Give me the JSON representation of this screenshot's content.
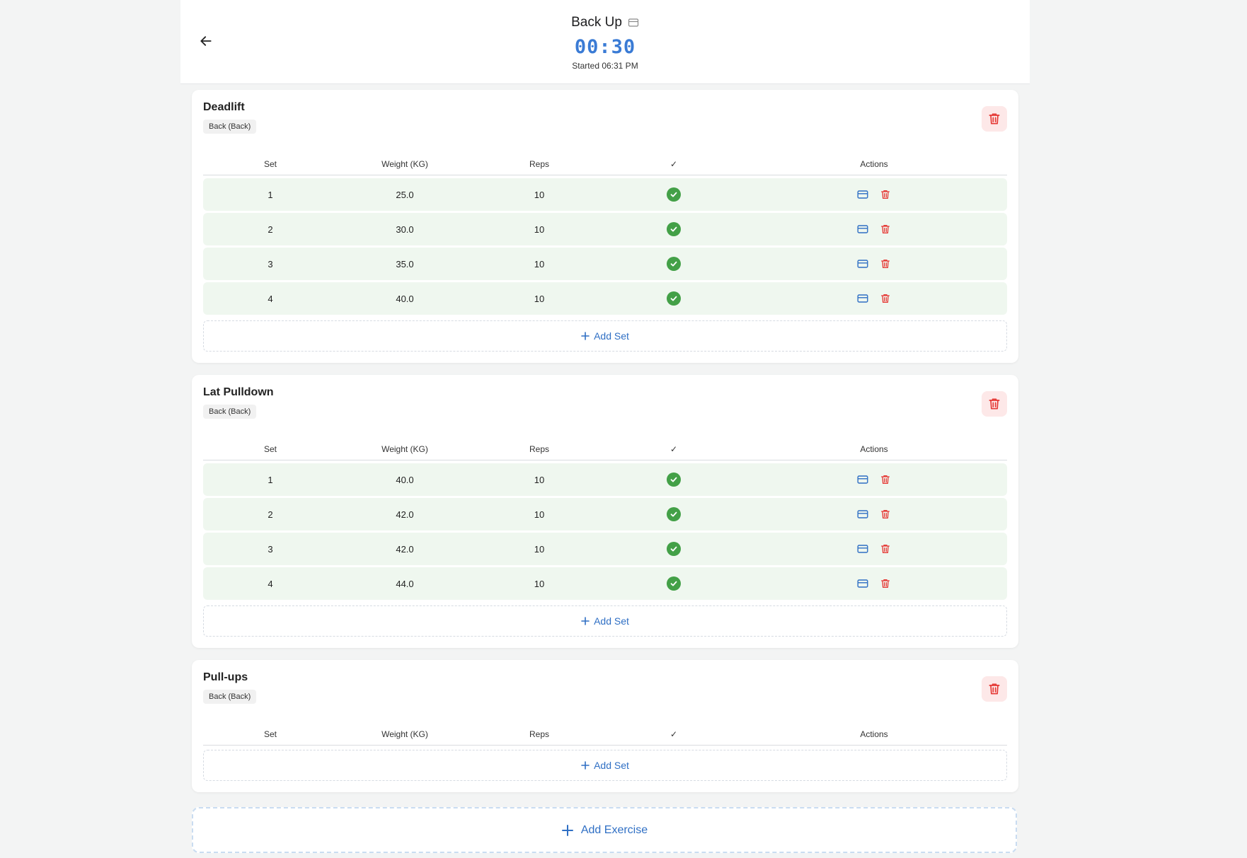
{
  "header": {
    "title": "Back Up",
    "timer": "00:30",
    "started": "Started 06:31 PM"
  },
  "table_headers": {
    "set": "Set",
    "weight": "Weight (KG)",
    "reps": "Reps",
    "done": "✓",
    "actions": "Actions"
  },
  "add_set_label": "Add Set",
  "add_exercise_label": "Add Exercise",
  "colors": {
    "accent": "#3a7bd5",
    "done_green": "#43a047",
    "row_bg": "#eff7ef",
    "delete_red": "#e53935",
    "delete_bg": "#fde8e8"
  },
  "icons": {
    "back": "arrow-left-icon",
    "title_edit": "card-icon",
    "delete": "trash-icon",
    "edit": "card-icon",
    "done": "check-circle-icon",
    "add": "plus-icon"
  },
  "exercises": [
    {
      "name": "Deadlift",
      "tag": "Back (Back)",
      "sets": [
        {
          "set": "1",
          "weight": "25.0",
          "reps": "10",
          "done": true
        },
        {
          "set": "2",
          "weight": "30.0",
          "reps": "10",
          "done": true
        },
        {
          "set": "3",
          "weight": "35.0",
          "reps": "10",
          "done": true
        },
        {
          "set": "4",
          "weight": "40.0",
          "reps": "10",
          "done": true
        }
      ]
    },
    {
      "name": "Lat Pulldown",
      "tag": "Back (Back)",
      "sets": [
        {
          "set": "1",
          "weight": "40.0",
          "reps": "10",
          "done": true
        },
        {
          "set": "2",
          "weight": "42.0",
          "reps": "10",
          "done": true
        },
        {
          "set": "3",
          "weight": "42.0",
          "reps": "10",
          "done": true
        },
        {
          "set": "4",
          "weight": "44.0",
          "reps": "10",
          "done": true
        }
      ]
    },
    {
      "name": "Pull-ups",
      "tag": "Back (Back)",
      "sets": []
    }
  ]
}
